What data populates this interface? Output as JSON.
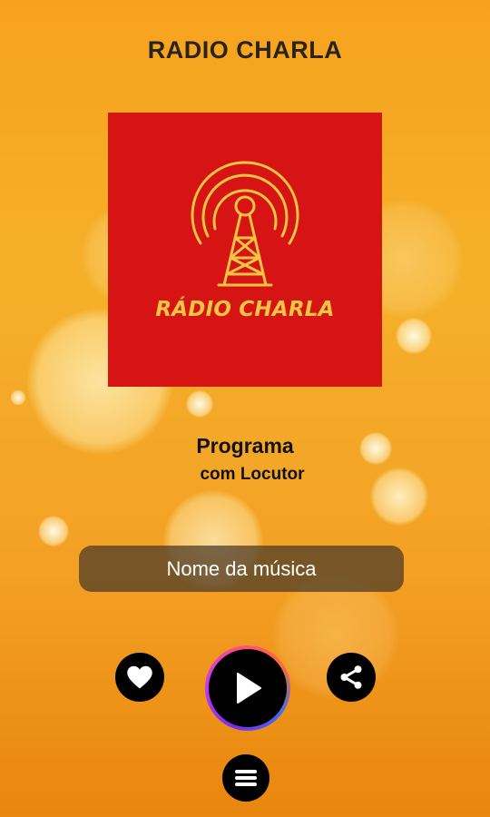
{
  "header": {
    "title": "RADIO CHARLA"
  },
  "logo": {
    "text": "RÁDIO CHARLA",
    "icon": "radio-tower-icon",
    "background": "#d61414",
    "accent": "#f4c542"
  },
  "program": {
    "title": "Programa",
    "host": "com Locutor"
  },
  "player": {
    "song_name": "Nome da música"
  },
  "controls": {
    "favorite_icon": "heart-icon",
    "play_icon": "play-icon",
    "share_icon": "share-icon",
    "menu_icon": "menu-icon"
  },
  "colors": {
    "background": "#f5a623",
    "button": "#000000"
  }
}
